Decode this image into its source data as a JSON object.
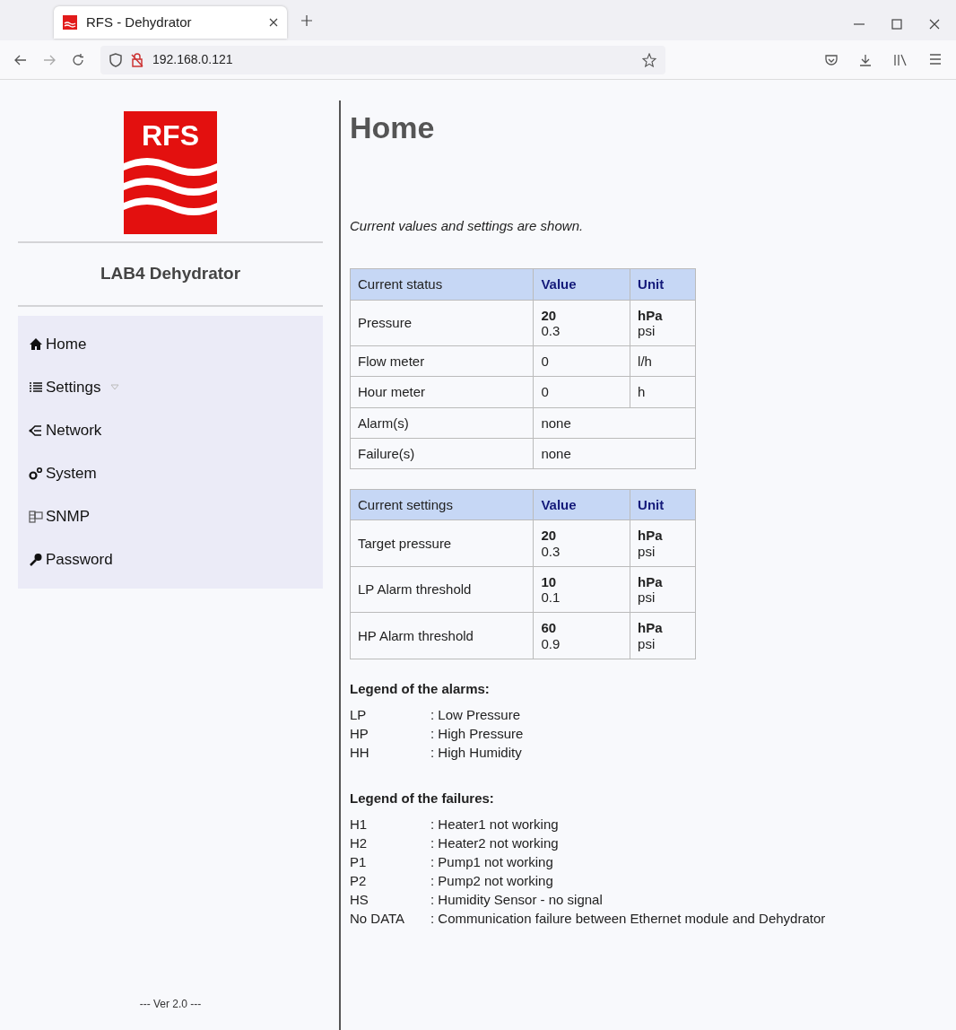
{
  "browser": {
    "tab_title": "RFS - Dehydrator",
    "url": "192.168.0.121"
  },
  "sidebar": {
    "logo_text": "RFS",
    "title": "LAB4 Dehydrator",
    "items": [
      {
        "label": "Home",
        "submenu": false
      },
      {
        "label": "Settings",
        "submenu": true
      },
      {
        "label": "Network",
        "submenu": false
      },
      {
        "label": "System",
        "submenu": false
      },
      {
        "label": "SNMP",
        "submenu": false
      },
      {
        "label": "Password",
        "submenu": false
      }
    ],
    "version": "--- Ver 2.0 ---"
  },
  "page": {
    "title": "Home",
    "intro": "Current values and settings are shown.",
    "tables": [
      {
        "columns": [
          "Current status",
          "Value",
          "Unit"
        ],
        "rows": [
          {
            "label": "Pressure",
            "values": [
              "20",
              "0.3"
            ],
            "units": [
              "hPa",
              "psi"
            ]
          },
          {
            "label": "Flow meter",
            "values": [
              "0"
            ],
            "units": [
              "l/h"
            ]
          },
          {
            "label": "Hour meter",
            "values": [
              "0"
            ],
            "units": [
              "h"
            ]
          },
          {
            "label": "Alarm(s)",
            "values": [
              "none"
            ]
          },
          {
            "label": "Failure(s)",
            "values": [
              "none"
            ]
          }
        ]
      },
      {
        "columns": [
          "Current settings",
          "Value",
          "Unit"
        ],
        "rows": [
          {
            "label": "Target pressure",
            "values": [
              "20",
              "0.3"
            ],
            "units": [
              "hPa",
              "psi"
            ]
          },
          {
            "label": "LP Alarm threshold",
            "values": [
              "10",
              "0.1"
            ],
            "units": [
              "hPa",
              "psi"
            ]
          },
          {
            "label": "HP Alarm threshold",
            "values": [
              "60",
              "0.9"
            ],
            "units": [
              "hPa",
              "psi"
            ]
          }
        ]
      }
    ],
    "legends": [
      {
        "heading": "Legend of the alarms:",
        "entries": [
          {
            "code": "LP",
            "text": ": Low Pressure"
          },
          {
            "code": "HP",
            "text": ": High Pressure"
          },
          {
            "code": "HH",
            "text": ": High Humidity"
          }
        ]
      },
      {
        "heading": "Legend of the failures:",
        "entries": [
          {
            "code": "H1",
            "text": ": Heater1 not working"
          },
          {
            "code": "H2",
            "text": ": Heater2 not working"
          },
          {
            "code": "P1",
            "text": ": Pump1 not working"
          },
          {
            "code": "P2",
            "text": ": Pump2 not working"
          },
          {
            "code": "HS",
            "text": ": Humidity Sensor - no signal"
          },
          {
            "code": "No DATA",
            "text": ": Communication failure between Ethernet module and Dehydrator"
          }
        ]
      }
    ]
  }
}
